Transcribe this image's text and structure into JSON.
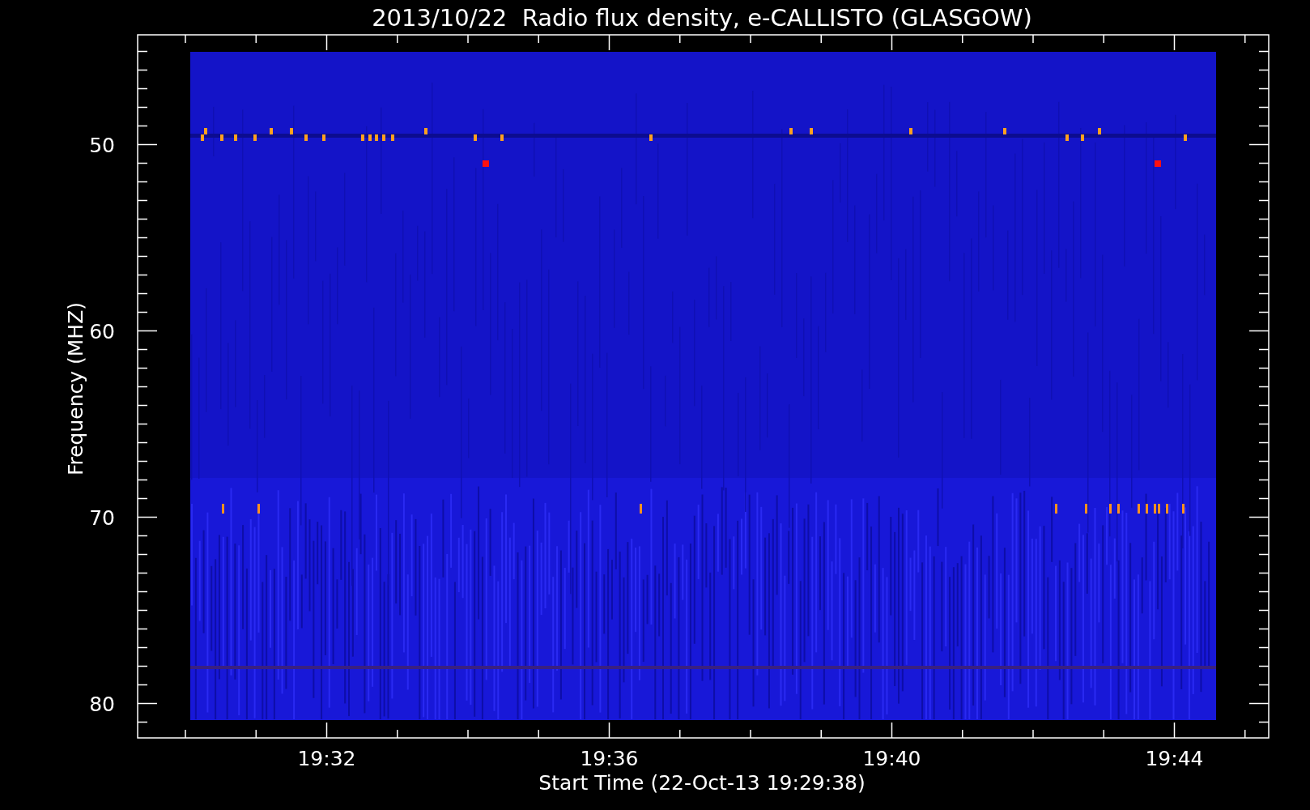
{
  "title": "2013/10/22  Radio flux density, e-CALLISTO (GLASGOW)",
  "plot": {
    "ylabel": "Frequency (MHZ)",
    "xlabel": "Start Time (22-Oct-13 19:29:38)",
    "yticks": [
      "50",
      "60",
      "70",
      "80"
    ],
    "xticks": [
      "19:32",
      "19:36",
      "19:40",
      "19:44"
    ]
  }
}
